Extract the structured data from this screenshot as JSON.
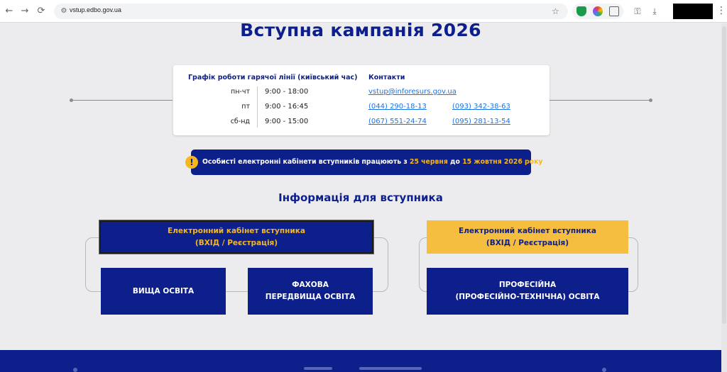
{
  "browser": {
    "url": "vstup.edbo.gov.ua",
    "back_icon": "←",
    "forward_icon": "→",
    "reload_icon": "⟳",
    "site_info_icon": "⚙",
    "bookmark_icon": "☆",
    "passwords_icon": "⚿",
    "downloads_icon": "⤓",
    "menu_icon": "⋮"
  },
  "page": {
    "title": "Вступна кампанія 2026"
  },
  "hotline": {
    "heading": "Графік роботи гарячої лінії (київський час)",
    "rows": [
      {
        "day": "пн-чт",
        "time": "9:00 - 18:00"
      },
      {
        "day": "пт",
        "time": "9:00 - 16:45"
      },
      {
        "day": "сб-нд",
        "time": "9:00 - 15:00"
      }
    ]
  },
  "contacts": {
    "heading": "Контакти",
    "email": "vstup@inforesurs.gov.ua",
    "phones": [
      "(044) 290-18-13",
      "(093) 342-38-63",
      "(067) 551-24-74",
      "(095) 281-13-54"
    ]
  },
  "notice": {
    "icon": "!",
    "text_before": "Особисті електронні кабінети вступників працюють з",
    "date_start": "25 червня",
    "text_middle": "до",
    "date_end": "15 жовтня 2026 року"
  },
  "info": {
    "title": "Інформація для вступника",
    "cabinet_line1": "Електронний кабінет вступника",
    "cabinet_line2": "(ВХІД / Реєстрація)",
    "higher_education": "ВИЩА ОСВІТА",
    "professional_prehigher_line1": "ФАХОВА",
    "professional_prehigher_line2": "ПЕРЕДВИЩА ОСВІТА",
    "vocational_line1": "ПРОФЕСІЙНА",
    "vocational_line2": "(ПРОФЕСІЙНО-ТЕХНІЧНА) ОСВІТА"
  },
  "colors": {
    "brand_blue": "#0c1f8a",
    "accent_yellow": "#f5b61e",
    "link_blue": "#1a73e8",
    "page_bg": "#ececee"
  }
}
